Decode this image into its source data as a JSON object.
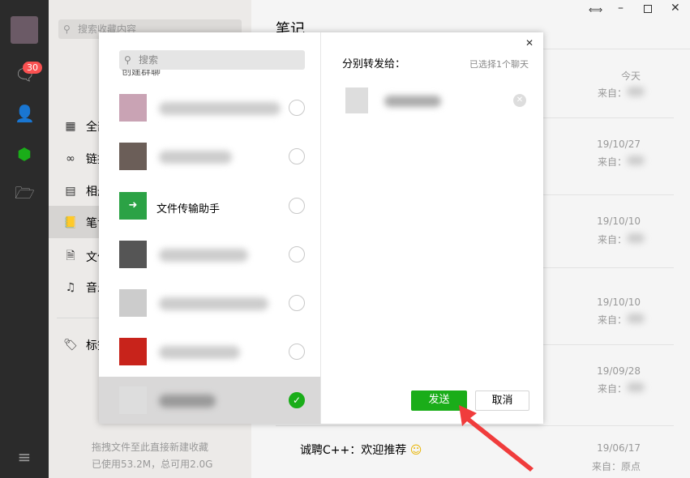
{
  "nav": {
    "badge_count": "30",
    "icons": [
      "avatar",
      "chat-icon",
      "contacts-icon",
      "favorites-icon",
      "folder-icon",
      "menu-icon"
    ]
  },
  "mid": {
    "search_placeholder": "搜索收藏内容",
    "categories": [
      "全部",
      "链接",
      "相册",
      "笔记",
      "文件",
      "音乐"
    ],
    "tags_label": "标签",
    "drop_hint": "拖拽文件至此直接新建收藏",
    "usage": "已使用53.2M，总可用2.0G"
  },
  "main": {
    "title": "笔记",
    "window_controls": [
      "pin",
      "minimize",
      "maximize",
      "close"
    ],
    "notes": [
      {
        "date": "今天",
        "from": "来自："
      },
      {
        "date": "19/10/27",
        "from": "来自："
      },
      {
        "date": "19/10/10",
        "from": "来自："
      },
      {
        "date": "19/10/10",
        "from": "来自："
      },
      {
        "date": "19/09/28",
        "from": "来自："
      },
      {
        "date": "19/06/17",
        "from": "来自：原点",
        "text": "诚聘C++：欢迎推荐"
      }
    ]
  },
  "modal": {
    "search_placeholder": "搜索",
    "partial_item": "创建群聊",
    "file_helper": "文件传输助手",
    "title": "分别转发给：",
    "selected_count": "已选择1个聊天",
    "send": "发送",
    "cancel": "取消"
  },
  "colors": {
    "accent": "#1aad19",
    "arrow": "#f03c3c"
  }
}
